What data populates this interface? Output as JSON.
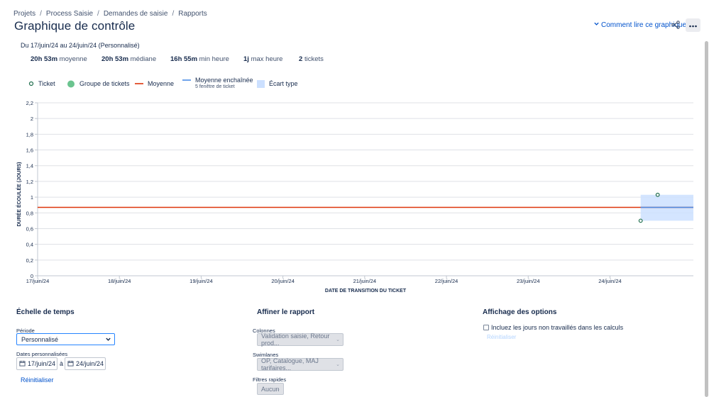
{
  "breadcrumb": [
    "Projets",
    "Process Saisie",
    "Demandes de saisie",
    "Rapports"
  ],
  "page_title": "Graphique de contrôle",
  "how_to_read": "Comment lire ce graphique",
  "date_range": "Du 17/juin/24 au 24/juin/24 (Personnalisé)",
  "stats": [
    {
      "value": "20h 53m",
      "label": "moyenne"
    },
    {
      "value": "20h 53m",
      "label": "médiane"
    },
    {
      "value": "16h 55m",
      "label": "min heure"
    },
    {
      "value": "1j",
      "label": "max heure"
    },
    {
      "value": "2",
      "label": "tickets"
    }
  ],
  "legend": {
    "ticket": "Ticket",
    "group": "Groupe de tickets",
    "average": "Moyenne",
    "rolling": "Moyenne enchaînée",
    "rolling_sub": "5 fenêtre de ticket",
    "std": "Écart type"
  },
  "colors": {
    "ticket_stroke": "#216e4e",
    "group_fill": "#6bc48f",
    "average": "#de350b",
    "rolling": "#4c8de6",
    "std_band": "#cce0ff",
    "grid": "#dfe1e6",
    "link": "#0052cc"
  },
  "chart_data": {
    "type": "scatter",
    "ylabel": "DURÉE ÉCOULÉE (JOURS)",
    "xlabel": "DATE DE TRANSITION DU TICKET",
    "ylim": [
      0,
      2.2
    ],
    "yticks": [
      "0",
      "0,2",
      "0,4",
      "0,6",
      "0,8",
      "1",
      "1,2",
      "1,4",
      "1,6",
      "1,8",
      "2",
      "2,2"
    ],
    "xticks": [
      "17/juin/24",
      "18/juin/24",
      "19/juin/24",
      "20/juin/24",
      "21/juin/24",
      "22/juin/24",
      "23/juin/24",
      "24/juin/24"
    ],
    "xlim": [
      "17/juin/24",
      "25/juin/24"
    ],
    "grid": true,
    "points": [
      {
        "x": "24/juin/24 9h",
        "y": 0.7
      },
      {
        "x": "24/juin/24 14h",
        "y": 1.03
      }
    ],
    "average": 0.87,
    "rolling_average": {
      "x_start": "24/juin/24 9h",
      "x_end": "25/juin/24",
      "y": 0.87
    },
    "std_band": {
      "x_start": "24/juin/24 9h",
      "x_end": "25/juin/24",
      "y_low": 0.7,
      "y_high": 1.03
    }
  },
  "time_scale": {
    "title": "Échelle de temps",
    "period_label": "Période",
    "period_value": "Personnalisé",
    "custom_dates_label": "Dates personnalisées",
    "start_date": "17/juin/24",
    "between": "à",
    "end_date": "24/juin/24",
    "reset": "Réinitialiser"
  },
  "refine": {
    "title": "Affiner le rapport",
    "columns_label": "Colonnes",
    "columns_value": "Validation saisie, Retour prod...",
    "swimlanes_label": "Swimlanes",
    "swimlanes_value": "OP, Catalogue, MAJ tarifaires...",
    "quick_filters_label": "Filtres rapides",
    "quick_filters_value": "Aucun"
  },
  "display_options": {
    "title": "Affichage des options",
    "include_nonworking": "Incluez les jours non travaillés dans les calculs",
    "reset": "Réinitialiser"
  }
}
